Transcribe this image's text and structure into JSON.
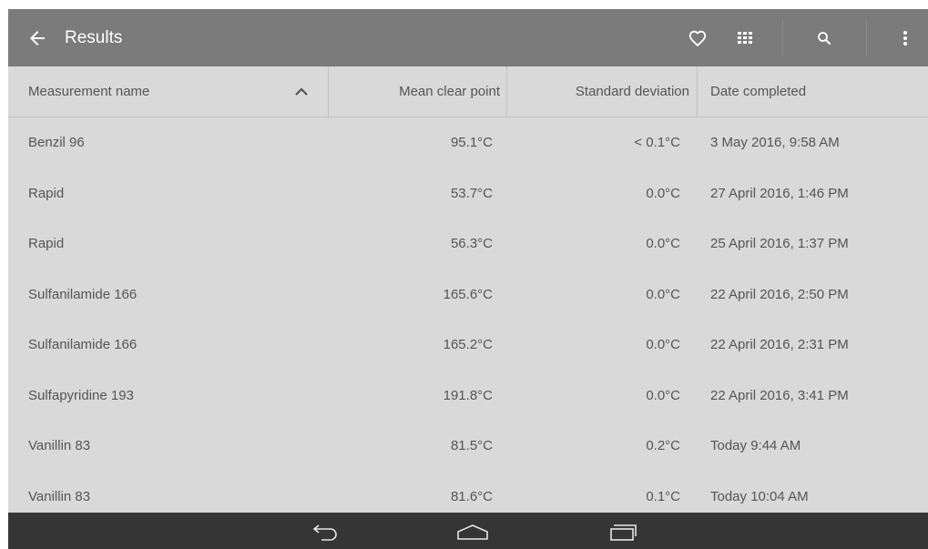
{
  "appbar": {
    "title": "Results",
    "icons": [
      "back-arrow-icon",
      "heart-icon",
      "grid-icon",
      "search-icon",
      "overflow-menu-icon"
    ]
  },
  "table": {
    "headers": [
      "Measurement name",
      "Mean clear point",
      "Standard deviation",
      "Date completed"
    ],
    "sort_column": "Measurement name",
    "sort_direction": "ascending",
    "rows": [
      [
        "Benzil 96",
        "95.1°C",
        "< 0.1°C",
        "3 May 2016, 9:58 AM"
      ],
      [
        "Rapid",
        "53.7°C",
        "0.0°C",
        "27 April 2016, 1:46 PM"
      ],
      [
        "Rapid",
        "56.3°C",
        "0.0°C",
        "25 April 2016, 1:37 PM"
      ],
      [
        "Sulfanilamide 166",
        "165.6°C",
        "0.0°C",
        "22 April 2016, 2:50 PM"
      ],
      [
        "Sulfanilamide 166",
        "165.2°C",
        "0.0°C",
        "22 April 2016, 2:31 PM"
      ],
      [
        "Sulfapyridine 193",
        "191.8°C",
        "0.0°C",
        "22 April 2016, 3:41 PM"
      ],
      [
        "Vanillin 83",
        "81.5°C",
        "0.2°C",
        "Today 9:44 AM"
      ],
      [
        "Vanillin 83",
        "81.6°C",
        "0.1°C",
        "Today 10:04 AM"
      ]
    ]
  },
  "navbar": {
    "icons": [
      "nav-back-icon",
      "nav-home-icon",
      "nav-recents-icon"
    ]
  },
  "colors": {
    "appbar": "#7b7b7b",
    "background": "#d9d9d9",
    "navbar": "#353535",
    "text": "#555555"
  }
}
